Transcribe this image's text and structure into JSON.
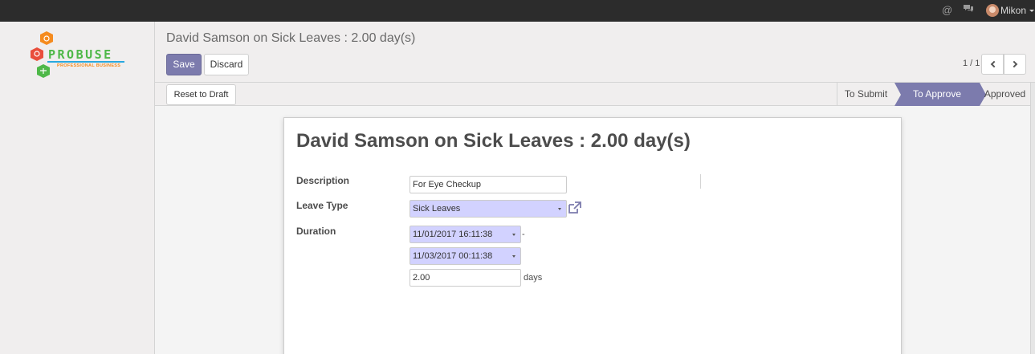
{
  "topbar": {
    "at_icon": "at-icon",
    "chat_icon": "chat-bubbles-icon",
    "user_name": "Mikon"
  },
  "logo": {
    "word": "PROBUSE",
    "tagline": "PROFESSIONAL BUSINESS"
  },
  "breadcrumb": "David Samson on Sick Leaves : 2.00 day(s)",
  "buttons": {
    "save": "Save",
    "discard": "Discard",
    "reset": "Reset to Draft"
  },
  "pager": {
    "value": "1 / 1"
  },
  "statusbar": {
    "steps": [
      "To Submit",
      "To Approve",
      "Approved"
    ],
    "active_step": "To Approve"
  },
  "form": {
    "title": "David Samson on Sick Leaves : 2.00 day(s)",
    "description_label": "Description",
    "description_value": "For Eye Checkup",
    "leave_type_label": "Leave Type",
    "leave_type_value": "Sick Leaves",
    "duration_label": "Duration",
    "date_from": "11/01/2017 16:11:38",
    "date_separator": "-",
    "date_to": "11/03/2017 00:11:38",
    "days_value": "2.00",
    "days_unit": "days"
  },
  "colors": {
    "accent": "#7c7bad",
    "required_field": "#d2d2ff",
    "topbar": "#2c2c2c"
  }
}
